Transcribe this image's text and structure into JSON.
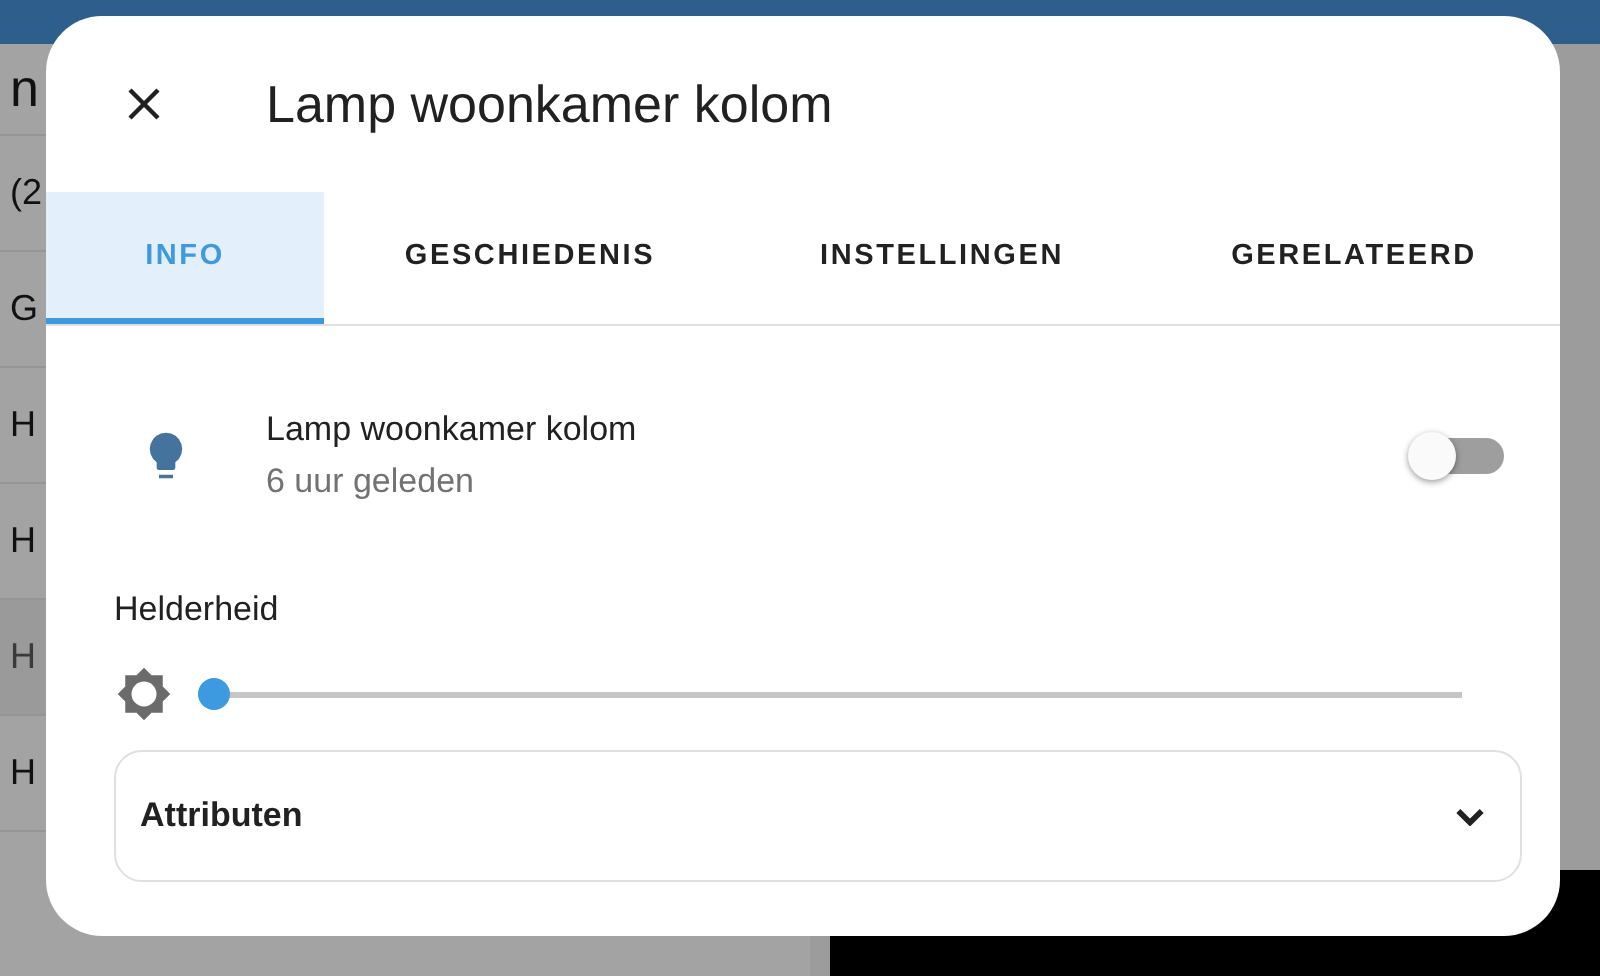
{
  "background": {
    "list_fragments": [
      "n",
      "(2",
      "G",
      "H",
      "H",
      "H",
      "H"
    ]
  },
  "dialog": {
    "title": "Lamp woonkamer kolom",
    "tabs": [
      {
        "label": "INFO",
        "selected": true
      },
      {
        "label": "GESCHIEDENIS",
        "selected": false
      },
      {
        "label": "INSTELLINGEN",
        "selected": false
      },
      {
        "label": "GERELATEERD",
        "selected": false
      }
    ],
    "entity": {
      "name": "Lamp woonkamer kolom",
      "secondary": "6 uur geleden",
      "on": false
    },
    "brightness": {
      "label": "Helderheid",
      "level": 0
    },
    "attributes": {
      "label": "Attributen",
      "expanded": false
    }
  }
}
